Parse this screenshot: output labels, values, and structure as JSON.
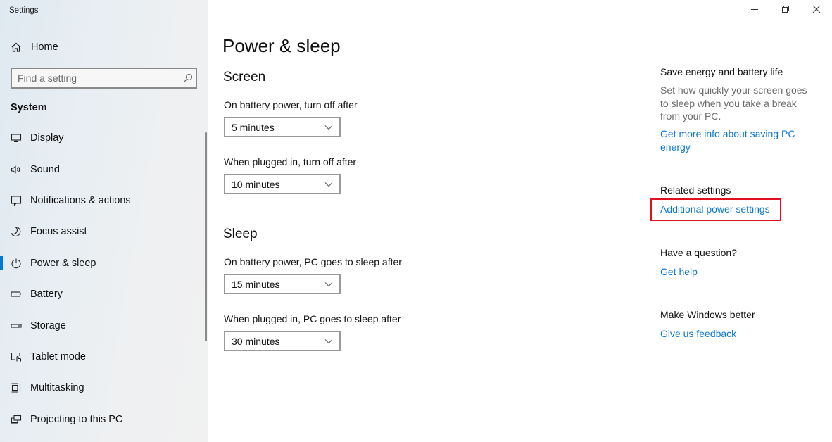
{
  "window": {
    "title": "Settings",
    "controls": [
      {
        "name": "minimize",
        "icon": "minimize-icon"
      },
      {
        "name": "restore",
        "icon": "restore-icon"
      },
      {
        "name": "close",
        "icon": "close-icon"
      }
    ]
  },
  "sidebar": {
    "home_label": "Home",
    "search": {
      "placeholder": "Find a setting",
      "value": ""
    },
    "section_label": "System",
    "items": [
      {
        "label": "Display",
        "icon": "display-icon",
        "active": false
      },
      {
        "label": "Sound",
        "icon": "speaker-icon",
        "active": false
      },
      {
        "label": "Notifications & actions",
        "icon": "notification-icon",
        "active": false
      },
      {
        "label": "Focus assist",
        "icon": "moon-icon",
        "active": false
      },
      {
        "label": "Power & sleep",
        "icon": "power-icon",
        "active": true
      },
      {
        "label": "Battery",
        "icon": "battery-icon",
        "active": false
      },
      {
        "label": "Storage",
        "icon": "storage-icon",
        "active": false
      },
      {
        "label": "Tablet mode",
        "icon": "tablet-mode-icon",
        "active": false
      },
      {
        "label": "Multitasking",
        "icon": "multitasking-icon",
        "active": false
      },
      {
        "label": "Projecting to this PC",
        "icon": "projecting-icon",
        "active": false
      }
    ]
  },
  "main": {
    "title": "Power & sleep",
    "screen": {
      "title": "Screen",
      "battery_label": "On battery power, turn off after",
      "battery_value": "5 minutes",
      "plugged_label": "When plugged in, turn off after",
      "plugged_value": "10 minutes"
    },
    "sleep": {
      "title": "Sleep",
      "battery_label": "On battery power, PC goes to sleep after",
      "battery_value": "15 minutes",
      "plugged_label": "When plugged in, PC goes to sleep after",
      "plugged_value": "30 minutes"
    }
  },
  "aside": {
    "save_energy": {
      "heading": "Save energy and battery life",
      "description": "Set how quickly your screen goes to sleep when you take a break from your PC.",
      "link": "Get more info about saving PC energy"
    },
    "related": {
      "heading": "Related settings",
      "link": "Additional power settings"
    },
    "question": {
      "heading": "Have a question?",
      "link": "Get help"
    },
    "feedback": {
      "heading": "Make Windows better",
      "link": "Give us feedback"
    }
  },
  "colors": {
    "accent": "#0078d7",
    "link": "#0a78d4",
    "highlight": "#e0111f"
  }
}
